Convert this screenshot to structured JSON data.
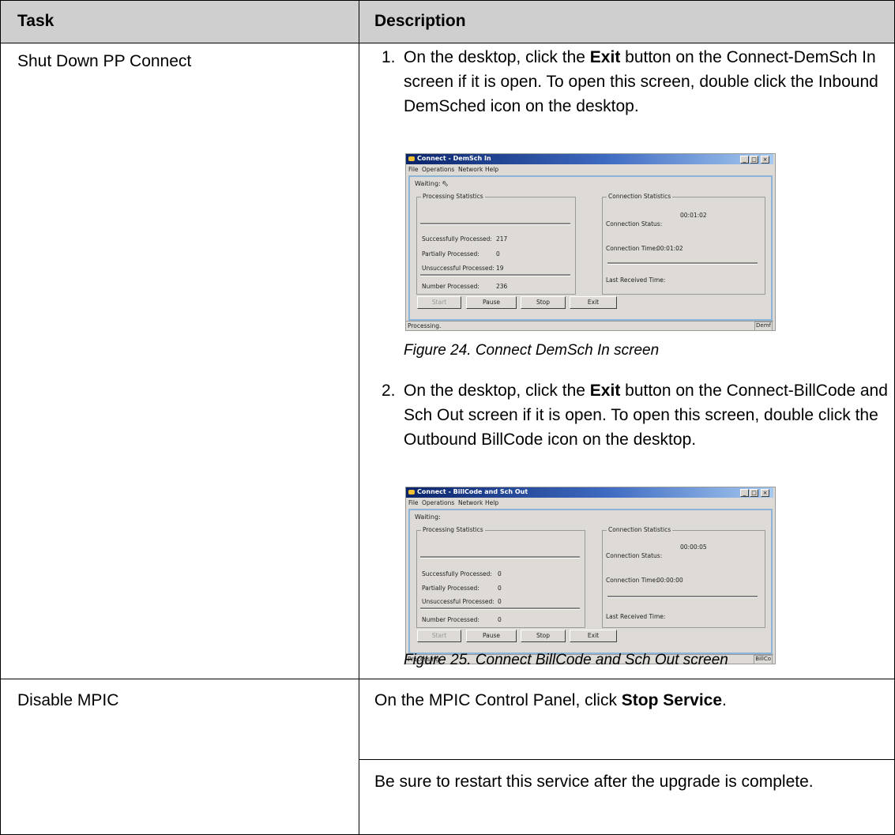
{
  "table": {
    "header": {
      "task": "Task",
      "description": "Description"
    },
    "rows": [
      {
        "task": "Shut Down PP Connect",
        "steps": [
          {
            "number": "1.",
            "text_before": "On the desktop, click the ",
            "bold": "Exit",
            "text_after": " button on the Connect-DemSch In screen if it is open. To open this screen, double click the Inbound DemSched icon on the desktop.",
            "caption": "Figure 24.  Connect DemSch In screen",
            "window": {
              "title": "Connect - DemSch In",
              "menus": [
                "File",
                "Operations",
                "Network",
                "Help"
              ],
              "waiting": "Waiting:",
              "processing_group": "Processing Statistics",
              "connection_group": "Connection Statistics",
              "success_label": "Successfully Processed:",
              "success_value": "217",
              "partial_label": "Partially Processed:",
              "partial_value": "0",
              "unsuccess_label": "Unsuccessful Processed:",
              "unsuccess_value": "19",
              "number_label": "Number Processed:",
              "number_value": "236",
              "conn_status_label": "Connection Status:",
              "conn_status_value": "00:01:02",
              "conn_time_label": "Connection Time:",
              "conn_time_value": "00:01:02",
              "last_received_label": "Last Received Time:",
              "buttons": {
                "start": "Start",
                "pause": "Pause",
                "stop": "Stop",
                "exit": "Exit"
              },
              "status_text": "Processing.",
              "status_right": "Demf"
            }
          },
          {
            "number": "2.",
            "text_before": "On the desktop, click the ",
            "bold": "Exit",
            "text_after": " button on the Connect-BillCode and Sch Out screen if it is open. To open this screen, double click the Outbound BillCode icon on the desktop.",
            "caption": "Figure 25.  Connect BillCode and Sch Out screen",
            "window": {
              "title": "Connect - BillCode and Sch Out",
              "menus": [
                "File",
                "Operations",
                "Network",
                "Help"
              ],
              "waiting": "Waiting:",
              "processing_group": "Processing Statistics",
              "connection_group": "Connection Statistics",
              "success_label": "Successfully Processed:",
              "success_value": "0",
              "partial_label": "Partially Processed:",
              "partial_value": "0",
              "unsuccess_label": "Unsuccessful Processed:",
              "unsuccess_value": "0",
              "number_label": "Number Processed:",
              "number_value": "0",
              "conn_status_label": "Connection Status:",
              "conn_status_value": "00:00:05",
              "conn_time_label": "Connection Time:",
              "conn_time_value": "00:00:00",
              "last_received_label": "Last Received Time:",
              "buttons": {
                "start": "Start",
                "pause": "Pause",
                "stop": "Stop",
                "exit": "Exit"
              },
              "status_text": "Processing.",
              "status_right": "BillCo"
            }
          }
        ]
      },
      {
        "task": "Disable MPIC",
        "line1_before": "On the MPIC Control Panel, click ",
        "line1_bold": "Stop Service",
        "line1_after": ".",
        "line2": "Be sure to restart this service after the upgrade is complete."
      }
    ]
  },
  "colors": {
    "header_bg": "#cfcfcf",
    "border": "#000000",
    "window_bg": "#dedbd6",
    "titlebar": "#0a246a"
  }
}
